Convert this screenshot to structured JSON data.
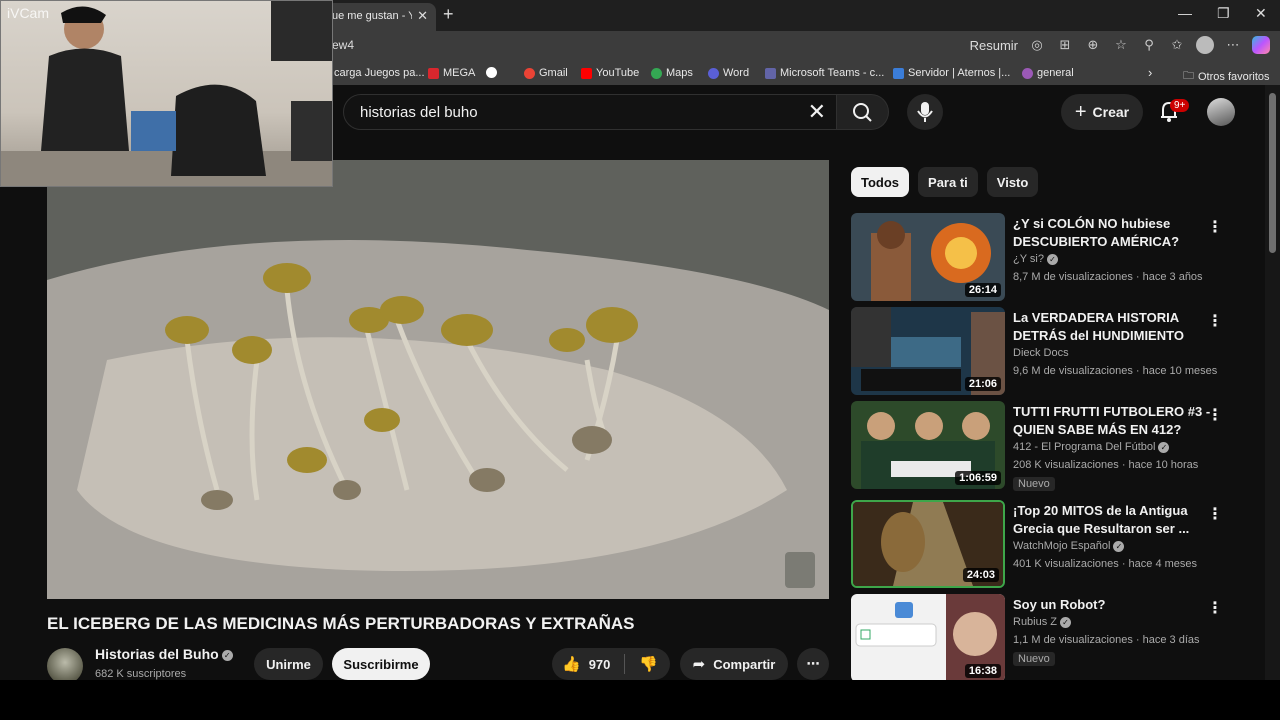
{
  "browser": {
    "tab_title": "ue me gustan - Yo",
    "url": "ew4",
    "reading_mode": "Resumir",
    "bookmarks": [
      {
        "label": "carga Juegos pa...",
        "color": "#7a7a7a"
      },
      {
        "label": "MEGA",
        "color": "#d9272e"
      },
      {
        "label": "",
        "color": "#ffffff"
      },
      {
        "label": "Gmail",
        "color": "#ea4335"
      },
      {
        "label": "YouTube",
        "color": "#ff0000"
      },
      {
        "label": "Maps",
        "color": "#34a853"
      },
      {
        "label": "Word",
        "color": "#5a5fd6"
      },
      {
        "label": "Microsoft Teams - c...",
        "color": "#6264a7"
      },
      {
        "label": "Servidor | Aternos |...",
        "color": "#3b7dd8"
      },
      {
        "label": "general",
        "color": "#9b59b6"
      }
    ],
    "bookmarks_folder": "Otros favoritos"
  },
  "webcam": {
    "label": "iVCam"
  },
  "youtube": {
    "search": {
      "query": "historias del buho"
    },
    "create_label": "Crear",
    "notifications_badge": "9+",
    "video": {
      "title": "EL ICEBERG DE LAS MEDICINAS MÁS PERTURBADORAS Y EXTRAÑAS",
      "channel": "Historias del Buho",
      "subscribers": "682 K suscriptores",
      "join_label": "Unirme",
      "subscribe_label": "Suscribirme",
      "likes": "970",
      "share_label": "Compartir"
    },
    "chips": [
      "Todos",
      "Para ti",
      "Visto"
    ],
    "recommendations": [
      {
        "title": "¿Y si COLÓN NO hubiese DESCUBIERTO AMÉRICA?",
        "channel": "¿Y si?",
        "meta": "8,7 M de visualizaciones · hace 3 años",
        "duration": "26:14",
        "new": ""
      },
      {
        "title": "La VERDADERA HISTORIA DETRÁS del HUNDIMIENTO de...",
        "channel": "Dieck Docs",
        "meta": "9,6 M de visualizaciones · hace 10 meses",
        "duration": "21:06",
        "new": ""
      },
      {
        "title": "TUTTI FRUTTI FUTBOLERO #3 - QUIEN SABE MÁS EN 412?",
        "channel": "412 - El Programa Del Fútbol",
        "meta": "208 K visualizaciones · hace 10 horas",
        "duration": "1:06:59",
        "new": "Nuevo"
      },
      {
        "title": "¡Top 20 MITOS de la Antigua Grecia que Resultaron ser ...",
        "channel": "WatchMojo Español",
        "meta": "401 K visualizaciones · hace 4 meses",
        "duration": "24:03",
        "new": ""
      },
      {
        "title": "Soy un Robot?",
        "channel": "Rubius Z",
        "meta": "1,1 M de visualizaciones · hace 3 días",
        "duration": "16:38",
        "new": "Nuevo"
      }
    ]
  }
}
